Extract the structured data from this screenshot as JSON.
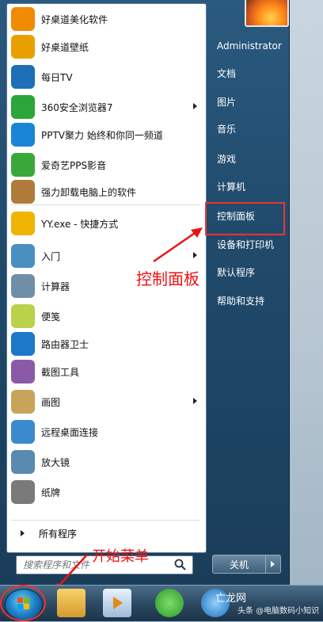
{
  "programs": [
    {
      "label": "好桌道美化软件",
      "icon": "hzd-beautify-icon",
      "color": "#f08a00"
    },
    {
      "label": "好桌道壁纸",
      "icon": "hzd-wallpaper-icon",
      "color": "#e8a000"
    },
    {
      "label": "每日TV",
      "icon": "daily-tv-icon",
      "color": "#1d6fb8"
    },
    {
      "label": "360安全浏览器7",
      "icon": "browser-360-icon",
      "color": "#2aa63a",
      "submenu": true
    },
    {
      "label": "PPTV聚力 始终和你同一频道",
      "icon": "pptv-icon",
      "color": "#1a84d6"
    },
    {
      "label": "爱奇艺PPS影音",
      "icon": "iqiyi-icon",
      "color": "#39a83b"
    },
    {
      "label": "强力卸载电脑上的软件",
      "icon": "uninstall-icon",
      "color": "#b07a3a"
    },
    {
      "label": "YY.exe - 快捷方式",
      "icon": "yy-icon",
      "color": "#f0b400"
    },
    {
      "label": "入门",
      "icon": "getting-started-icon",
      "color": "#4a8fc2",
      "submenu": true
    },
    {
      "label": "计算器",
      "icon": "calculator-icon",
      "color": "#6f8fa8"
    },
    {
      "label": "便笺",
      "icon": "sticky-notes-icon",
      "color": "#b8d24a"
    },
    {
      "label": "路由器卫士",
      "icon": "router-guard-icon",
      "color": "#1c78c8"
    },
    {
      "label": "截图工具",
      "icon": "snipping-tool-icon",
      "color": "#8a5aa8"
    },
    {
      "label": "画图",
      "icon": "paint-icon",
      "color": "#c8a35a",
      "submenu": true
    },
    {
      "label": "远程桌面连接",
      "icon": "remote-desktop-icon",
      "color": "#3a8ad0"
    },
    {
      "label": "放大镜",
      "icon": "magnifier-icon",
      "color": "#5a8ab0"
    },
    {
      "label": "纸牌",
      "icon": "solitaire-icon",
      "color": "#7a7a7a"
    }
  ],
  "all_programs_label": "所有程序",
  "search": {
    "placeholder": "搜索程序和文件"
  },
  "right_pane": [
    "Administrator",
    "文档",
    "图片",
    "音乐",
    "游戏",
    "计算机",
    "控制面板",
    "设备和打印机",
    "默认程序",
    "帮助和支持"
  ],
  "shutdown_label": "关机",
  "annotations": {
    "control_panel": "控制面板",
    "start_menu": "开始菜单"
  },
  "watermark": {
    "main": "亡龙网",
    "small": "头条 @电脑数码小知识"
  },
  "colors": {
    "accent_red": "#e11111",
    "menu_blue": "#204a6b"
  }
}
